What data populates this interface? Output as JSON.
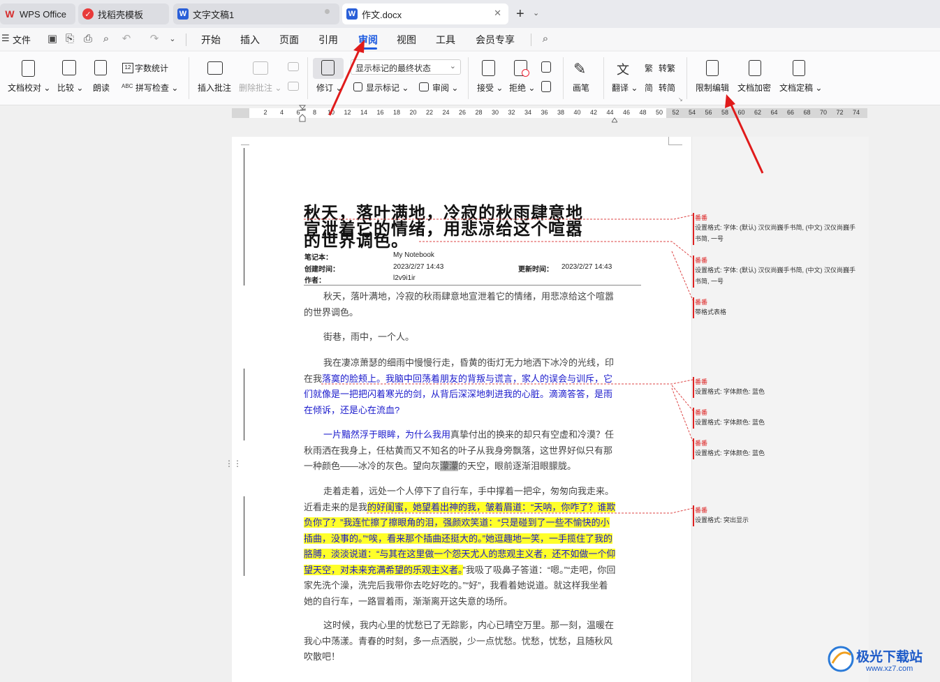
{
  "tabs": [
    {
      "icon": "wps-logo-icon",
      "label": "WPS Office"
    },
    {
      "icon": "template-icon",
      "label": "找稻壳模板"
    },
    {
      "icon": "word-doc-icon",
      "label": "文字文稿1"
    },
    {
      "icon": "word-doc-icon",
      "label": "作文.docx"
    }
  ],
  "tab_add_label": "+",
  "menu": {
    "file": "文件",
    "items": [
      "开始",
      "插入",
      "页面",
      "引用",
      "审阅",
      "视图",
      "工具",
      "会员专享"
    ],
    "active": "审阅"
  },
  "ribbon": {
    "proofread": "文档校对",
    "compare": "比较",
    "read_aloud": "朗读",
    "word_count": "字数统计",
    "spell_check": "拼写检查",
    "insert_comment": "插入批注",
    "delete_comment": "删除批注",
    "revise": "修订",
    "display_state": "显示标记的最终状态",
    "show_markup": "显示标记",
    "review": "审阅",
    "accept": "接受",
    "reject": "拒绝",
    "draw": "画笔",
    "translate": "翻译",
    "to_traditional": "转繁",
    "to_simplified": "转简",
    "restrict_edit": "限制编辑",
    "encrypt": "文档加密",
    "finalize": "文档定稿"
  },
  "ruler_ticks": [
    "2",
    "4",
    "6",
    "8",
    "10",
    "12",
    "14",
    "16",
    "18",
    "20",
    "22",
    "24",
    "26",
    "28",
    "30",
    "32",
    "34",
    "36",
    "38",
    "40",
    "42",
    "44",
    "46",
    "48",
    "50",
    "52",
    "54",
    "56",
    "58",
    "60",
    "62",
    "64",
    "66",
    "68",
    "70",
    "72",
    "74"
  ],
  "document": {
    "title_lines": [
      "秋天，落叶满地，冷寂的秋雨肆意地",
      "宣泄着它的情绪，用悲凉给这个喧嚣",
      "的世界调色。"
    ],
    "meta": {
      "notebook_label": "笔记本：",
      "notebook": "My Notebook",
      "created_label": "创建时间：",
      "created": "2023/2/27 14:43",
      "updated_label": "更新时间：",
      "updated": "2023/2/27 14:43",
      "author_label": "作者：",
      "author": "l2v9i1ir"
    },
    "p1": "秋天，落叶满地，冷寂的秋雨肆意地宣泄着它的情绪，用悲凉给这个喧嚣的世界调色。",
    "p2": "街巷，雨中，一个人。",
    "p3a": "我在凄凉萧瑟的细雨中慢慢行走，昏黄的街灯无力地洒下冰冷的光线，印在我",
    "p3b": "落寞的脸颊上。我脑中回荡着朋友的背叛与谎言，家人的误会与训斥，它们就像是一把把闪着寒光的剑，从背后深深地刺进我的心脏。滴滴答答，是雨在倾诉，还是心在流血?",
    "p4a": "一片黯然浮于眼眸，为什么我用",
    "p4b": "真挚付出的换来的却只有空虚和冷漠？任秋雨洒在我身上，任枯黄而又不知名的叶子从我身旁飘落，这世界好似只有那一种颜色——冰冷的灰色。望向灰",
    "p4c": "濛濛",
    "p4d": "的天空，眼前逐渐泪眼朦胧。",
    "p5a": "走着走着，远处一个人停下了自行车，手中撑着一把伞，匆匆向我走来。近看走来的是我",
    "p5b": "的好闺蜜，她望着出神的我，皱着眉道：“天呐，你咋了？谁欺负你了？”我连忙擦了擦眼角的泪，强颜欢笑道：“只是碰到了一些不愉快的小插曲，没事的。”“唉，看来那个插曲还挺大的。”她逗趣地一笑，一手揽住了我的胳膊，淡淡说道：“与其在这里做一个怨天尤人的悲观主义者，还不如做一个仰望天空，对未来充满希望的乐观主义者。",
    "p5c": "”我吸了吸鼻子答道：“嗯。”“走吧，你回家先洗个澡，洗完后我带你去吃好吃的。”“好”，我看着她说道。就这样我坐着她的自行车，一路冒着雨，渐渐离开这失意的场所。",
    "p6": "这时候，我内心里的忧愁已了无踪影，内心已晴空万里。那一刻，温暖在我心中荡漾。青春的时刻，多一点洒脱，少一点忧愁。忧愁，忧愁，且随秋风吹散吧！"
  },
  "comments": [
    {
      "author": "番番",
      "text": "设置格式: 字体: (默认) 汉仪尚巍手书简, (中文) 汉仪尚巍手书简, 一号"
    },
    {
      "author": "番番",
      "text": "设置格式: 字体: (默认) 汉仪尚巍手书简, (中文) 汉仪尚巍手书简, 一号"
    },
    {
      "author": "番番",
      "text": "带格式表格"
    },
    {
      "author": "番番",
      "text": "设置格式: 字体颜色: 蓝色"
    },
    {
      "author": "番番",
      "text": "设置格式: 字体颜色: 蓝色"
    },
    {
      "author": "番番",
      "text": "设置格式: 字体颜色: 蓝色"
    },
    {
      "author": "番番",
      "text": "设置格式: 突出显示"
    }
  ],
  "watermark": {
    "brand": "极光下载站",
    "url": "www.xz7.com"
  },
  "colors": {
    "accent": "#1f5ce0",
    "comment_red": "#d22222",
    "highlight": "#ffff2a",
    "revision_blue": "#1a1acc",
    "arrow": "#e01b1b"
  }
}
